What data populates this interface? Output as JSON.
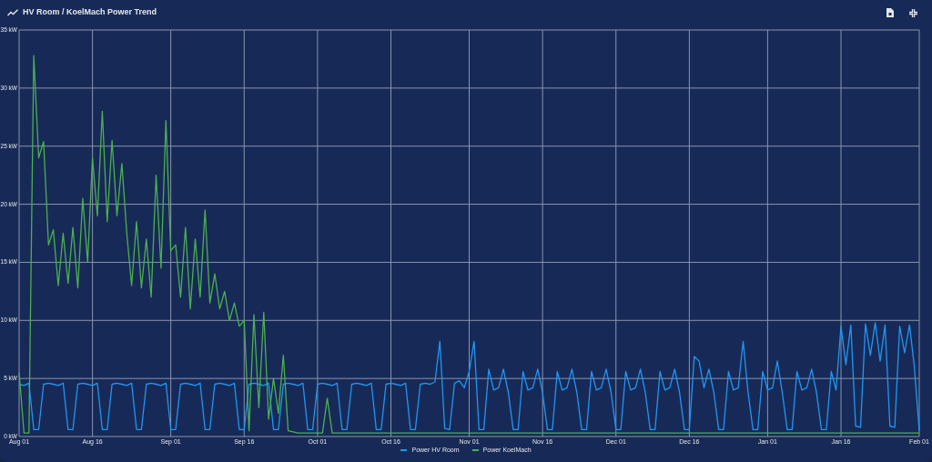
{
  "card": {
    "title": "HV Room / KoelMach Power Trend"
  },
  "chart_data": {
    "type": "line",
    "grid": true,
    "ylim": [
      0,
      35
    ],
    "yticks": [
      {
        "value": 0,
        "label": "0 kW"
      },
      {
        "value": 5,
        "label": "5 kW"
      },
      {
        "value": 10,
        "label": "10 kW"
      },
      {
        "value": 15,
        "label": "15 kW"
      },
      {
        "value": 20,
        "label": "20 kW"
      },
      {
        "value": 25,
        "label": "25 kW"
      },
      {
        "value": 30,
        "label": "30 kW"
      },
      {
        "value": 35,
        "label": "35 kW"
      }
    ],
    "categories": [
      "Aug 01",
      null,
      null,
      null,
      null,
      null,
      null,
      null,
      null,
      null,
      null,
      null,
      null,
      null,
      null,
      "Aug 16",
      null,
      null,
      null,
      null,
      null,
      null,
      null,
      null,
      null,
      null,
      null,
      null,
      null,
      null,
      null,
      "Sep 01",
      null,
      null,
      null,
      null,
      null,
      null,
      null,
      null,
      null,
      null,
      null,
      null,
      null,
      null,
      "Sep 16",
      null,
      null,
      null,
      null,
      null,
      null,
      null,
      null,
      null,
      null,
      null,
      null,
      null,
      null,
      "Oct 01",
      null,
      null,
      null,
      null,
      null,
      null,
      null,
      null,
      null,
      null,
      null,
      null,
      null,
      null,
      "Oct 16",
      null,
      null,
      null,
      null,
      null,
      null,
      null,
      null,
      null,
      null,
      null,
      null,
      null,
      null,
      null,
      "Nov 01",
      null,
      null,
      null,
      null,
      null,
      null,
      null,
      null,
      null,
      null,
      null,
      null,
      null,
      null,
      "Nov 16",
      null,
      null,
      null,
      null,
      null,
      null,
      null,
      null,
      null,
      null,
      null,
      null,
      null,
      null,
      "Dec 01",
      null,
      null,
      null,
      null,
      null,
      null,
      null,
      null,
      null,
      null,
      null,
      null,
      null,
      null,
      "Dec 16",
      null,
      null,
      null,
      null,
      null,
      null,
      null,
      null,
      null,
      null,
      null,
      null,
      null,
      null,
      null,
      "Jan 01",
      null,
      null,
      null,
      null,
      null,
      null,
      null,
      null,
      null,
      null,
      null,
      null,
      null,
      null,
      "Jan 16",
      null,
      null,
      null,
      null,
      null,
      null,
      null,
      null,
      null,
      null,
      null,
      null,
      null,
      null,
      null,
      "Feb 01"
    ],
    "series": [
      {
        "name": "Power HV Room",
        "color": "#2196f3",
        "values": [
          4.5,
          4.4,
          4.6,
          0.6,
          0.6,
          4.5,
          4.6,
          4.5,
          4.4,
          4.6,
          0.6,
          0.6,
          4.5,
          4.6,
          4.5,
          4.4,
          4.6,
          0.6,
          0.6,
          4.5,
          4.6,
          4.5,
          4.4,
          4.6,
          0.6,
          0.6,
          4.5,
          4.6,
          4.5,
          4.4,
          4.6,
          0.6,
          0.6,
          4.5,
          4.6,
          4.5,
          4.4,
          4.6,
          0.6,
          0.6,
          4.5,
          4.6,
          4.5,
          4.4,
          4.6,
          0.6,
          0.6,
          4.5,
          4.6,
          4.5,
          4.4,
          4.6,
          0.6,
          0.6,
          4.5,
          4.6,
          4.5,
          4.4,
          4.6,
          0.6,
          0.6,
          4.5,
          4.6,
          4.5,
          4.4,
          4.6,
          0.6,
          0.6,
          4.5,
          4.6,
          4.5,
          4.4,
          4.6,
          0.6,
          0.6,
          4.5,
          4.6,
          4.5,
          4.4,
          4.6,
          0.6,
          0.6,
          4.5,
          4.6,
          4.5,
          4.7,
          8.2,
          0.7,
          0.6,
          4.6,
          4.8,
          4.2,
          5.6,
          8.2,
          0.6,
          0.6,
          5.8,
          4.0,
          4.2,
          5.8,
          3.8,
          0.6,
          0.6,
          5.6,
          4.0,
          4.2,
          5.8,
          3.8,
          0.6,
          0.6,
          5.6,
          4.0,
          4.2,
          5.8,
          3.8,
          0.6,
          0.6,
          5.6,
          4.0,
          4.2,
          5.8,
          3.8,
          0.6,
          0.6,
          5.6,
          4.0,
          4.2,
          5.8,
          3.8,
          0.6,
          0.6,
          5.6,
          4.0,
          4.2,
          5.8,
          3.8,
          0.6,
          0.6,
          6.9,
          6.5,
          4.2,
          5.8,
          3.8,
          0.6,
          0.6,
          5.6,
          4.0,
          4.2,
          8.2,
          3.8,
          0.6,
          0.6,
          5.6,
          4.0,
          4.2,
          6.5,
          3.8,
          0.6,
          0.6,
          5.6,
          4.0,
          4.2,
          5.8,
          3.8,
          0.6,
          0.6,
          5.6,
          4.0,
          9.5,
          6.2,
          9.6,
          0.9,
          0.8,
          9.7,
          7.0,
          9.8,
          6.5,
          9.6,
          0.9,
          0.8,
          9.5,
          7.2,
          9.6,
          6.0,
          0.5
        ]
      },
      {
        "name": "Power KoelMach",
        "color": "#4caf50",
        "values": [
          5.5,
          0.3,
          0.3,
          32.8,
          24,
          25.4,
          16.5,
          17.8,
          13,
          17.5,
          13.2,
          18,
          12.8,
          20.5,
          15,
          24,
          19,
          28,
          18.5,
          25.5,
          19,
          23.5,
          17.5,
          13,
          18.5,
          12.8,
          17,
          12,
          22.5,
          14.5,
          27.2,
          16,
          16.5,
          12,
          18,
          11,
          17,
          12,
          19.5,
          11.5,
          14,
          11,
          12.5,
          10,
          11.5,
          9.5,
          10,
          0.5,
          10.5,
          2.5,
          10.7,
          1.5,
          5,
          2,
          7,
          0.5,
          0.4,
          0.3,
          0.3,
          0.3,
          0.3,
          0.3,
          0.3,
          3.3,
          0.3,
          0.3,
          0.3,
          0.3,
          0.3,
          0.3,
          0.3,
          0.3,
          0.3,
          0.3,
          0.3,
          0.3,
          0.3,
          0.3,
          0.3,
          0.3,
          0.3,
          0.3,
          0.3,
          0.3,
          0.3,
          0.3,
          0.3,
          0.3,
          0.3,
          0.3,
          0.3,
          0.3,
          0.3,
          0.3,
          0.3,
          0.3,
          0.3,
          0.3,
          0.3,
          0.3,
          0.3,
          0.3,
          0.3,
          0.3,
          0.3,
          0.3,
          0.3,
          0.3,
          0.3,
          0.3,
          0.3,
          0.3,
          0.3,
          0.3,
          0.3,
          0.3,
          0.3,
          0.3,
          0.3,
          0.3,
          0.3,
          0.3,
          0.3,
          0.3,
          0.3,
          0.3,
          0.3,
          0.3,
          0.3,
          0.3,
          0.3,
          0.3,
          0.3,
          0.3,
          0.3,
          0.3,
          0.3,
          0.3,
          0.3,
          0.3,
          0.3,
          0.3,
          0.3,
          0.3,
          0.3,
          0.3,
          0.3,
          0.3,
          0.3,
          0.3,
          0.3,
          0.3,
          0.3,
          0.3,
          0.3,
          0.3,
          0.3,
          0.3,
          0.3,
          0.3,
          0.3,
          0.3,
          0.3,
          0.3,
          0.3,
          0.3,
          0.3,
          0.3,
          0.3,
          0.3,
          0.3,
          0.3,
          0.3,
          0.3,
          0.3,
          0.3,
          0.3,
          0.3,
          0.3,
          0.3,
          0.3,
          0.3,
          0.3,
          0.3,
          0.3
        ]
      }
    ]
  }
}
